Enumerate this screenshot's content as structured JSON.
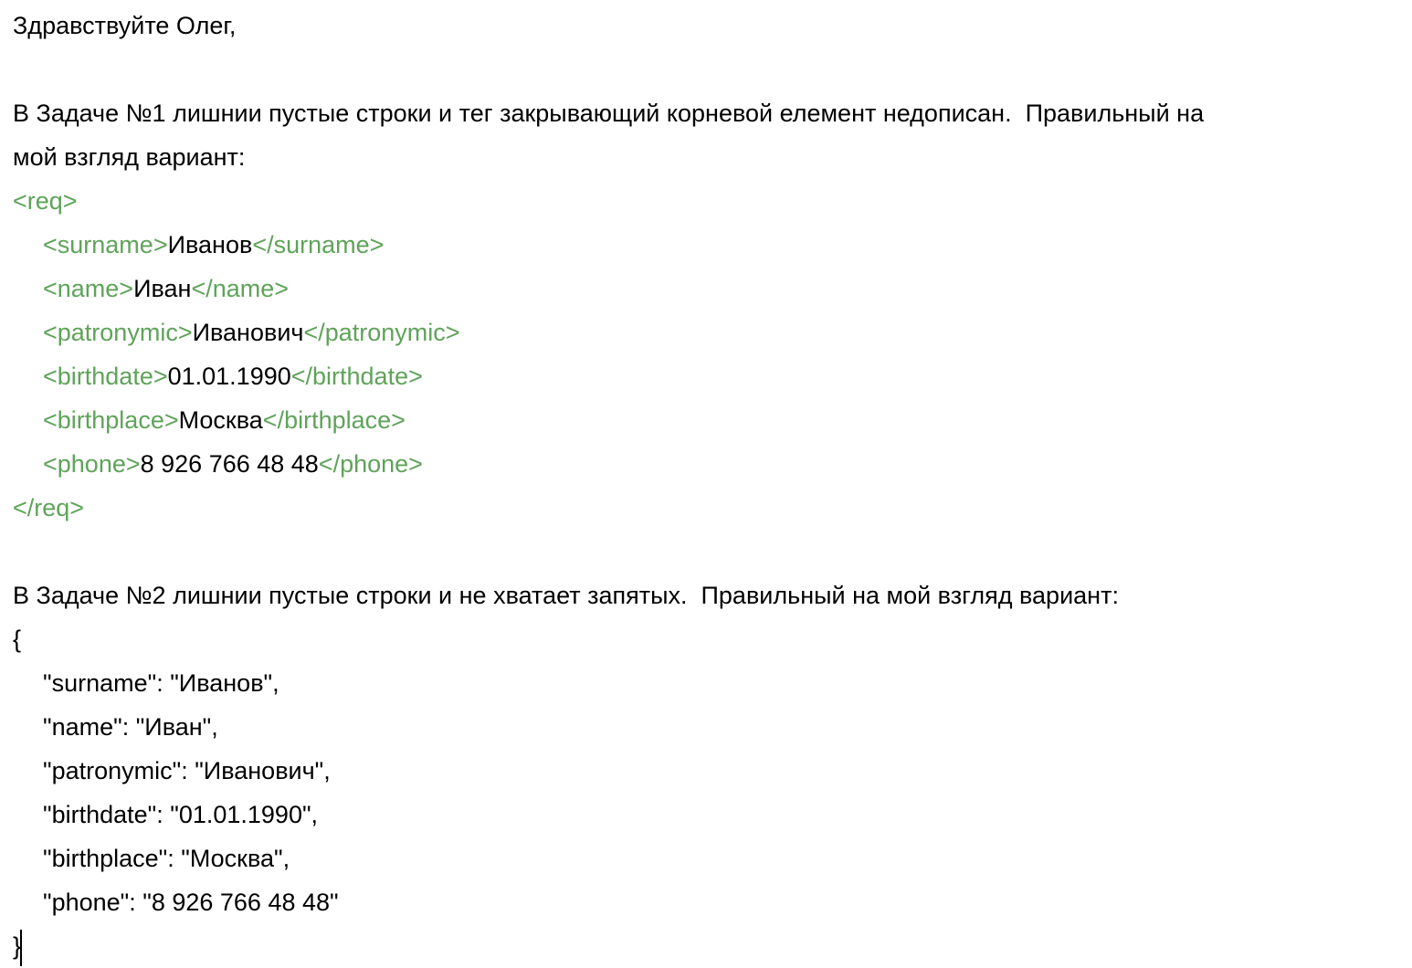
{
  "greeting": "Здравствуйте Олег,",
  "task1": {
    "intro_line1": "В Задаче №1 лишнии пустые строки и тег закрывающий корневой елемент недописан.  Правильный на",
    "intro_line2": "мой взгляд вариант:",
    "root_open": "<req>",
    "root_close": "</req>",
    "fields": [
      {
        "open": "<surname>",
        "value": "Иванов",
        "close": "</surname>"
      },
      {
        "open": "<name>",
        "value": "Иван",
        "close": "</name>"
      },
      {
        "open": "<patronymic>",
        "value": "Иванович",
        "close": "</patronymic>"
      },
      {
        "open": "<birthdate>",
        "value": "01.01.1990",
        "close": "</birthdate>"
      },
      {
        "open": "<birthplace>",
        "value": "Москва",
        "close": "</birthplace>"
      },
      {
        "open": "<phone>",
        "value": "8 926 766 48 48",
        "close": "</phone>"
      }
    ]
  },
  "task2": {
    "intro": "В Задаче №2 лишнии пустые строки и не хватает запятых.  Правильный на мой взгляд вариант:",
    "brace_open": "{",
    "brace_close": "}",
    "lines": [
      "\"surname\": \"Иванов\",",
      "\"name\": \"Иван\",",
      "\"patronymic\": \"Иванович\",",
      "\"birthdate\": \"01.01.1990\",",
      "\"birthplace\": \"Москва\",",
      "\"phone\": \"8 926 766 48 48\""
    ]
  },
  "colors": {
    "xml_tag": "#5fa35a",
    "text": "#000000",
    "background": "#ffffff"
  }
}
